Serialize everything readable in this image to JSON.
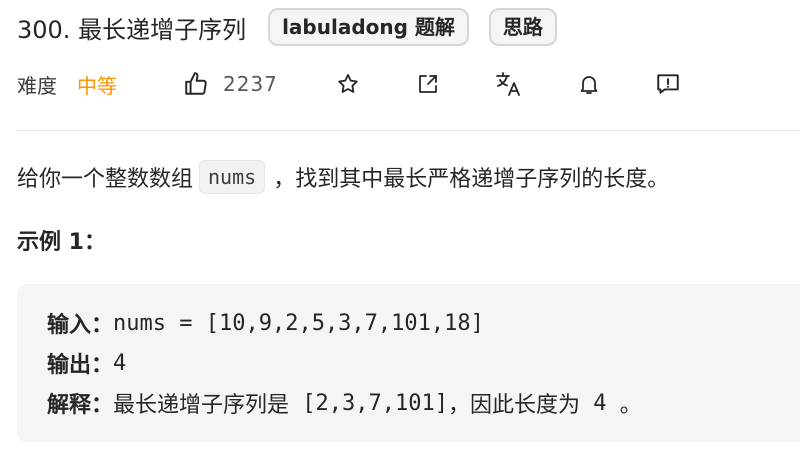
{
  "problem": {
    "title": "300. 最长递增子序列",
    "tags": [
      "labuladong 题解",
      "思路"
    ]
  },
  "meta": {
    "difficulty_label": "难度",
    "difficulty_value": "中等",
    "like_count": "2237"
  },
  "icons": {
    "like": "thumbs-up-icon",
    "favorite": "star-icon",
    "share": "share-icon",
    "translate": "translate-icon",
    "notify": "bell-icon",
    "feedback": "feedback-icon"
  },
  "colors": {
    "difficulty_medium": "#ff9500",
    "code_background": "#f5f5f5"
  },
  "description": {
    "before_code": "给你一个整数数组",
    "code": "nums",
    "after_code": "，找到其中最长严格递增子序列的长度。"
  },
  "example": {
    "title": "示例 1：",
    "input_label": "输入：",
    "input_value": "nums = [10,9,2,5,3,7,101,18]",
    "output_label": "输出：",
    "output_value": "4",
    "explanation_label": "解释：",
    "explanation_prefix": "最长递增子序列是",
    "explanation_seq": " [2,3,7,101]",
    "explanation_mid": "，因此长度为",
    "explanation_num": " 4 ",
    "explanation_end": "。"
  }
}
